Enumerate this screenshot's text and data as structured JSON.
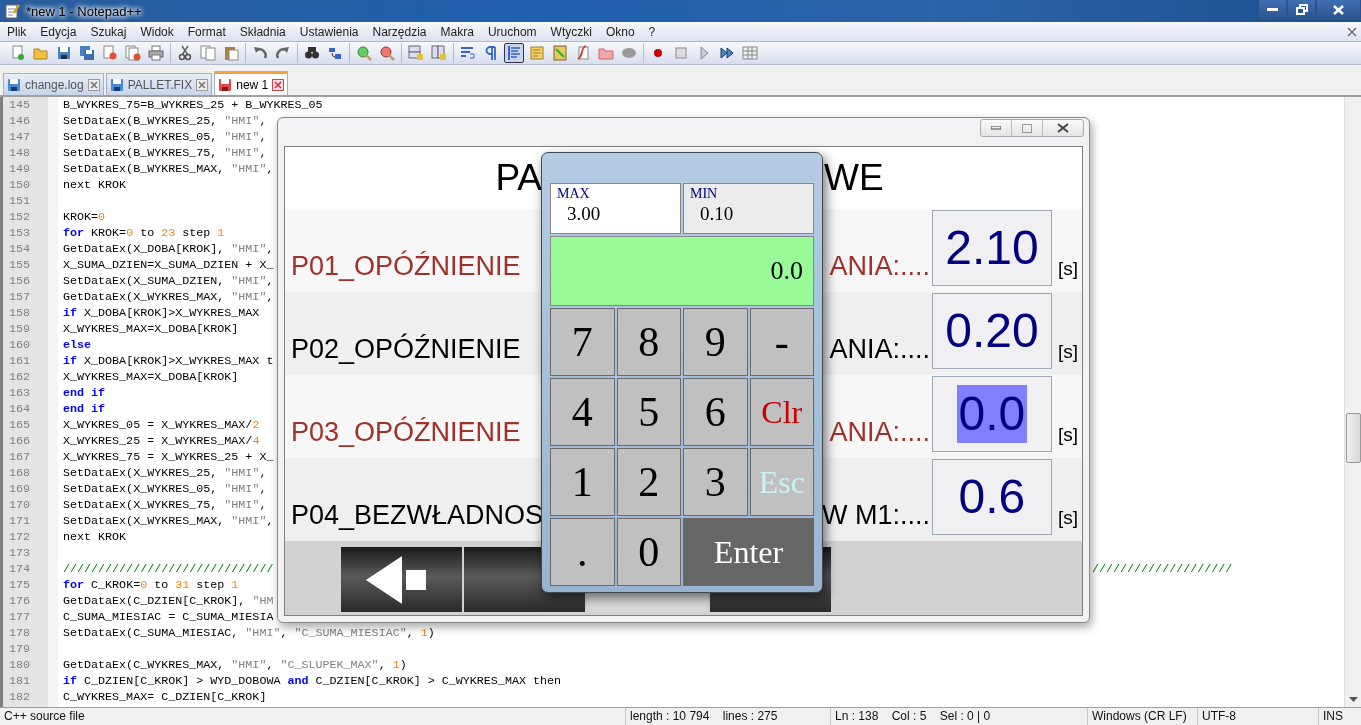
{
  "window": {
    "title": "*new 1 - Notepad++"
  },
  "menu": [
    "Plik",
    "Edycja",
    "Szukaj",
    "Widok",
    "Format",
    "Składnia",
    "Ustawienia",
    "Narzędzia",
    "Makra",
    "Uruchom",
    "Wtyczki",
    "Okno",
    "?"
  ],
  "toolbar": {
    "groups": [
      {
        "buttons": [
          {
            "pressed": false
          },
          {
            "pressed": false
          },
          {
            "pressed": false
          },
          {
            "pressed": false
          },
          {
            "pressed": false
          },
          {
            "pressed": false
          },
          {
            "pressed": false
          }
        ]
      },
      {
        "buttons": [
          {
            "pressed": false
          },
          {
            "pressed": false
          },
          {
            "pressed": false
          }
        ]
      },
      {
        "buttons": [
          {
            "pressed": false
          },
          {
            "pressed": false
          }
        ]
      },
      {
        "buttons": [
          {
            "pressed": false
          },
          {
            "pressed": false
          }
        ]
      },
      {
        "buttons": [
          {
            "pressed": false
          },
          {
            "pressed": false
          }
        ]
      },
      {
        "buttons": [
          {
            "pressed": false
          },
          {
            "pressed": false
          }
        ]
      },
      {
        "buttons": [
          {
            "pressed": false
          },
          {
            "pressed": false
          },
          {
            "pressed": true
          },
          {
            "pressed": false
          },
          {
            "pressed": false
          },
          {
            "pressed": false
          },
          {
            "pressed": false
          },
          {
            "pressed": false
          }
        ]
      },
      {
        "buttons": [
          {
            "pressed": false
          },
          {
            "pressed": false
          },
          {
            "pressed": false
          },
          {
            "pressed": false
          },
          {
            "pressed": false
          }
        ]
      }
    ]
  },
  "tabs": [
    {
      "label": "change.log",
      "selected": false,
      "modified": false
    },
    {
      "label": "PALLET.FIX",
      "selected": false,
      "modified": false
    },
    {
      "label": "new 1",
      "selected": true,
      "modified": true
    }
  ],
  "editor": {
    "lines": [
      {
        "n": "145",
        "parts": [
          {
            "kind": "plain",
            "t": "B_WYKRES_75=B_WYKRES_25 + B_WYKRES_05"
          }
        ]
      },
      {
        "n": "146",
        "parts": [
          {
            "kind": "plain",
            "t": "SetDataEx(B_WYKRES_25, "
          },
          {
            "kind": "string",
            "t": "\"HMI\""
          },
          {
            "kind": "plain",
            "t": ","
          }
        ]
      },
      {
        "n": "147",
        "parts": [
          {
            "kind": "plain",
            "t": "SetDataEx(B_WYKRES_05, "
          },
          {
            "kind": "string",
            "t": "\"HMI\""
          },
          {
            "kind": "plain",
            "t": ","
          }
        ]
      },
      {
        "n": "148",
        "parts": [
          {
            "kind": "plain",
            "t": "SetDataEx(B_WYKRES_75, "
          },
          {
            "kind": "string",
            "t": "\"HMI\""
          },
          {
            "kind": "plain",
            "t": ","
          }
        ]
      },
      {
        "n": "149",
        "parts": [
          {
            "kind": "plain",
            "t": "SetDataEx(B_WYKRES_MAX, "
          },
          {
            "kind": "string",
            "t": "\"HMI\""
          },
          {
            "kind": "plain",
            "t": ","
          }
        ]
      },
      {
        "n": "150",
        "parts": [
          {
            "kind": "plain",
            "t": "next KROK"
          }
        ]
      },
      {
        "n": "151"
      },
      {
        "n": "152",
        "parts": [
          {
            "kind": "plain",
            "t": "KROK="
          },
          {
            "kind": "number",
            "t": "0"
          }
        ]
      },
      {
        "n": "153",
        "parts": [
          {
            "kind": "keyword",
            "t": "for"
          },
          {
            "kind": "plain",
            "t": " KROK="
          },
          {
            "kind": "number",
            "t": "0"
          },
          {
            "kind": "plain",
            "t": " to "
          },
          {
            "kind": "number",
            "t": "23"
          },
          {
            "kind": "plain",
            "t": " step "
          },
          {
            "kind": "number",
            "t": "1"
          }
        ]
      },
      {
        "n": "154",
        "parts": [
          {
            "kind": "plain",
            "t": "GetDataEx(X_DOBA[KROK], "
          },
          {
            "kind": "string",
            "t": "\"HMI\""
          },
          {
            "kind": "plain",
            "t": ","
          }
        ]
      },
      {
        "n": "155",
        "parts": [
          {
            "kind": "plain",
            "t": "X_SUMA_DZIEN=X_SUMA_DZIEN + X_"
          }
        ]
      },
      {
        "n": "156",
        "parts": [
          {
            "kind": "plain",
            "t": "SetDataEx(X_SUMA_DZIEN, "
          },
          {
            "kind": "string",
            "t": "\"HMI\""
          },
          {
            "kind": "plain",
            "t": ","
          }
        ]
      },
      {
        "n": "157",
        "parts": [
          {
            "kind": "plain",
            "t": "GetDataEx(X_WYKRES_MAX, "
          },
          {
            "kind": "string",
            "t": "\"HMI\""
          },
          {
            "kind": "plain",
            "t": ","
          }
        ]
      },
      {
        "n": "158",
        "parts": [
          {
            "kind": "keyword",
            "t": "if"
          },
          {
            "kind": "plain",
            "t": " X_DOBA[KROK]>X_WYKRES_MAX"
          }
        ]
      },
      {
        "n": "159",
        "parts": [
          {
            "kind": "plain",
            "t": "X_WYKRES_MAX=X_DOBA[KROK]"
          }
        ]
      },
      {
        "n": "160",
        "parts": [
          {
            "kind": "keyword",
            "t": "else"
          }
        ]
      },
      {
        "n": "161",
        "parts": [
          {
            "kind": "keyword",
            "t": "if"
          },
          {
            "kind": "plain",
            "t": " X_DOBA[KROK]>X_WYKRES_MAX t"
          }
        ]
      },
      {
        "n": "162",
        "parts": [
          {
            "kind": "plain",
            "t": "X_WYKRES_MAX=X_DOBA[KROK]"
          }
        ]
      },
      {
        "n": "163",
        "parts": [
          {
            "kind": "keyword",
            "t": "end if"
          }
        ]
      },
      {
        "n": "164",
        "parts": [
          {
            "kind": "keyword",
            "t": "end if"
          }
        ]
      },
      {
        "n": "165",
        "parts": [
          {
            "kind": "plain",
            "t": "X_WYKRES_05 = X_WYKRES_MAX/"
          },
          {
            "kind": "number",
            "t": "2"
          }
        ]
      },
      {
        "n": "166",
        "parts": [
          {
            "kind": "plain",
            "t": "X_WYKRES_25 = X_WYKRES_MAX/"
          },
          {
            "kind": "number",
            "t": "4"
          }
        ]
      },
      {
        "n": "167",
        "parts": [
          {
            "kind": "plain",
            "t": "X_WYKRES_75 = X_WYKRES_25 + X_"
          }
        ]
      },
      {
        "n": "168",
        "parts": [
          {
            "kind": "plain",
            "t": "SetDataEx(X_WYKRES_25, "
          },
          {
            "kind": "string",
            "t": "\"HMI\""
          },
          {
            "kind": "plain",
            "t": ","
          }
        ]
      },
      {
        "n": "169",
        "parts": [
          {
            "kind": "plain",
            "t": "SetDataEx(X_WYKRES_05, "
          },
          {
            "kind": "string",
            "t": "\"HMI\""
          },
          {
            "kind": "plain",
            "t": ","
          }
        ]
      },
      {
        "n": "170",
        "parts": [
          {
            "kind": "plain",
            "t": "SetDataEx(X_WYKRES_75, "
          },
          {
            "kind": "string",
            "t": "\"HMI\""
          },
          {
            "kind": "plain",
            "t": ","
          }
        ]
      },
      {
        "n": "171",
        "parts": [
          {
            "kind": "plain",
            "t": "SetDataEx(X_WYKRES_MAX, "
          },
          {
            "kind": "string",
            "t": "\"HMI\""
          },
          {
            "kind": "plain",
            "t": ","
          }
        ]
      },
      {
        "n": "172",
        "parts": [
          {
            "kind": "plain",
            "t": "next KROK"
          }
        ]
      },
      {
        "n": "173"
      },
      {
        "n": "174",
        "parts": [
          {
            "kind": "comment",
            "t": "//////////////////////////////"
          }
        ],
        "tail": [
          {
            "kind": "comment",
            "t": "////////////////////"
          }
        ]
      },
      {
        "n": "175",
        "parts": [
          {
            "kind": "keyword",
            "t": "for"
          },
          {
            "kind": "plain",
            "t": " C_KROK="
          },
          {
            "kind": "number",
            "t": "0"
          },
          {
            "kind": "plain",
            "t": " to "
          },
          {
            "kind": "number",
            "t": "31"
          },
          {
            "kind": "plain",
            "t": " step "
          },
          {
            "kind": "number",
            "t": "1"
          }
        ]
      },
      {
        "n": "176",
        "parts": [
          {
            "kind": "plain",
            "t": "GetDataEx(C_DZIEN[C_KROK], "
          },
          {
            "kind": "string",
            "t": "\"HM"
          }
        ]
      },
      {
        "n": "177",
        "parts": [
          {
            "kind": "plain",
            "t": "C_SUMA_MIESIAC = C_SUMA_MIESIA"
          }
        ]
      },
      {
        "n": "178",
        "parts": [
          {
            "kind": "plain",
            "t": "SetDataEx(C_SUMA_MIESIAC, "
          },
          {
            "kind": "string",
            "t": "\"HMI\""
          },
          {
            "kind": "plain",
            "t": ", "
          },
          {
            "kind": "string",
            "t": "\"C_SUMA_MIESIAC\""
          },
          {
            "kind": "plain",
            "t": ", "
          },
          {
            "kind": "number",
            "t": "1"
          },
          {
            "kind": "plain",
            "t": ")"
          }
        ]
      },
      {
        "n": "179"
      },
      {
        "n": "180",
        "parts": [
          {
            "kind": "plain",
            "t": "GetDataEx(C_WYKRES_MAX, "
          },
          {
            "kind": "string",
            "t": "\"HMI\""
          },
          {
            "kind": "plain",
            "t": ", "
          },
          {
            "kind": "string",
            "t": "\"C_SLUPEK_MAX\""
          },
          {
            "kind": "plain",
            "t": ", "
          },
          {
            "kind": "number",
            "t": "1"
          },
          {
            "kind": "plain",
            "t": ")"
          }
        ]
      },
      {
        "n": "181",
        "parts": [
          {
            "kind": "keyword",
            "t": "if"
          },
          {
            "kind": "plain",
            "t": " C_DZIEN[C_KROK] > WYD_DOBOWA "
          },
          {
            "kind": "keyword",
            "t": "and"
          },
          {
            "kind": "plain",
            "t": " C_DZIEN[C_KROK] > C_WYKRES_MAX then"
          }
        ]
      },
      {
        "n": "182",
        "parts": [
          {
            "kind": "plain",
            "t": "C_WYKRES_MAX= C_DZIEN[C_KROK]"
          }
        ]
      }
    ]
  },
  "hmi": {
    "title_left": "PA",
    "title_right": "WE",
    "rows": [
      {
        "label_left": "P01_OPÓŹNIENIE",
        "label_right": "ANIA:....",
        "value": "2.10",
        "unit": "[s]",
        "color": "#a0302a",
        "selected": false
      },
      {
        "label_left": "P02_OPÓŹNIENIE",
        "label_right": "ANIA:....",
        "value": "0.20",
        "unit": "[s]",
        "color": "#000000",
        "selected": false
      },
      {
        "label_left": "P03_OPÓŹNIENIE",
        "label_right": "ANIA:....",
        "value": "0.0",
        "unit": "[s]",
        "color": "#a0302a",
        "selected": true
      },
      {
        "label_left": "P04_BEZWŁADNOS",
        "label_right": "W M1:....",
        "value": "0.6",
        "unit": "[s]",
        "color": "#000000",
        "selected": false
      }
    ]
  },
  "keypad": {
    "fields": [
      {
        "label": "MAX",
        "value": "3.00",
        "selected": true
      },
      {
        "label": "MIN",
        "value": "0.10",
        "selected": false
      }
    ],
    "display": "0.0",
    "keys": [
      {
        "label": "7",
        "kind": "digit"
      },
      {
        "label": "8",
        "kind": "digit"
      },
      {
        "label": "9",
        "kind": "digit"
      },
      {
        "label": "-",
        "kind": "digit"
      },
      {
        "label": "4",
        "kind": "digit"
      },
      {
        "label": "5",
        "kind": "digit"
      },
      {
        "label": "6",
        "kind": "digit"
      },
      {
        "label": "Clr",
        "kind": "clear"
      },
      {
        "label": "1",
        "kind": "digit"
      },
      {
        "label": "2",
        "kind": "digit"
      },
      {
        "label": "3",
        "kind": "digit"
      },
      {
        "label": "Esc",
        "kind": "escape"
      },
      {
        "label": ".",
        "kind": "digit"
      },
      {
        "label": "0",
        "kind": "digit"
      },
      {
        "label": "Enter",
        "kind": "enter"
      }
    ]
  },
  "status_bar": [
    "C++ source file",
    "length : 10 794    lines : 275",
    "Ln : 138    Col : 5    Sel : 0 | 0",
    "Windows (CR LF)",
    "UTF-8",
    "INS"
  ]
}
